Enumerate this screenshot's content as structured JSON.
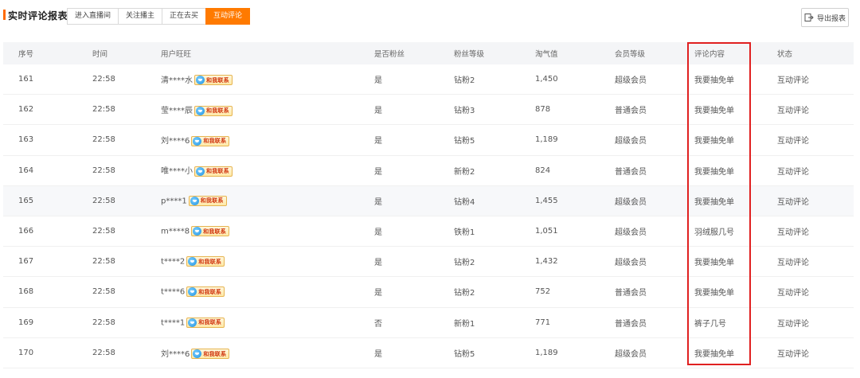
{
  "header": {
    "title": "实时评论报表",
    "tabs": [
      {
        "label": "进入直播间",
        "active": false
      },
      {
        "label": "关注播主",
        "active": false
      },
      {
        "label": "正在去买",
        "active": false
      },
      {
        "label": "互动评论",
        "active": true
      }
    ],
    "export_label": "导出报表",
    "accent_color": "#ff7a00",
    "highlight_color": "#e02020"
  },
  "table": {
    "columns": [
      "序号",
      "时间",
      "用户旺旺",
      "是否粉丝",
      "粉丝等级",
      "淘气值",
      "会员等级",
      "评论内容",
      "状态"
    ],
    "contact_label": "和我联系",
    "rows": [
      {
        "id": "161",
        "time": "22:58",
        "user": "清****水",
        "fan": "是",
        "fan_level": "钻粉2",
        "taoqi": "1,450",
        "member": "超级会员",
        "comment": "我要抽免单",
        "status": "互动评论"
      },
      {
        "id": "162",
        "time": "22:58",
        "user": "莹****辰",
        "fan": "是",
        "fan_level": "钻粉3",
        "taoqi": "878",
        "member": "普通会员",
        "comment": "我要抽免单",
        "status": "互动评论"
      },
      {
        "id": "163",
        "time": "22:58",
        "user": "刘****6",
        "fan": "是",
        "fan_level": "钻粉5",
        "taoqi": "1,189",
        "member": "超级会员",
        "comment": "我要抽免单",
        "status": "互动评论"
      },
      {
        "id": "164",
        "time": "22:58",
        "user": "唯****小",
        "fan": "是",
        "fan_level": "新粉2",
        "taoqi": "824",
        "member": "普通会员",
        "comment": "我要抽免单",
        "status": "互动评论"
      },
      {
        "id": "165",
        "time": "22:58",
        "user": "p****1",
        "fan": "是",
        "fan_level": "钻粉4",
        "taoqi": "1,455",
        "member": "超级会员",
        "comment": "我要抽免单",
        "status": "互动评论"
      },
      {
        "id": "166",
        "time": "22:58",
        "user": "m****8",
        "fan": "是",
        "fan_level": "铁粉1",
        "taoqi": "1,051",
        "member": "超级会员",
        "comment": "羽绒服几号",
        "status": "互动评论"
      },
      {
        "id": "167",
        "time": "22:58",
        "user": "t****2",
        "fan": "是",
        "fan_level": "钻粉2",
        "taoqi": "1,432",
        "member": "超级会员",
        "comment": "我要抽免单",
        "status": "互动评论"
      },
      {
        "id": "168",
        "time": "22:58",
        "user": "t****6",
        "fan": "是",
        "fan_level": "钻粉2",
        "taoqi": "752",
        "member": "普通会员",
        "comment": "我要抽免单",
        "status": "互动评论"
      },
      {
        "id": "169",
        "time": "22:58",
        "user": "t****1",
        "fan": "否",
        "fan_level": "新粉1",
        "taoqi": "771",
        "member": "普通会员",
        "comment": "裤子几号",
        "status": "互动评论"
      },
      {
        "id": "170",
        "time": "22:58",
        "user": "刘****6",
        "fan": "是",
        "fan_level": "钻粉5",
        "taoqi": "1,189",
        "member": "超级会员",
        "comment": "我要抽免单",
        "status": "互动评论"
      }
    ]
  }
}
